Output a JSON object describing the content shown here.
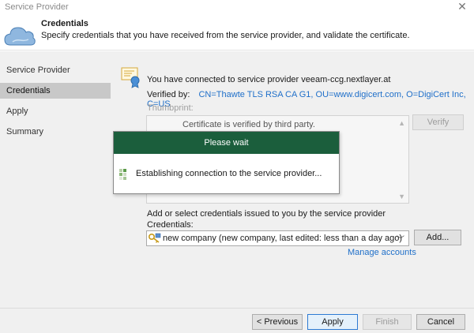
{
  "window": {
    "title": "Service Provider",
    "close_glyph": "✕"
  },
  "header": {
    "title": "Credentials",
    "subtitle": "Specify credentials that you have received from the service provider, and validate the certificate.",
    "icon": "cloud-icon"
  },
  "sidebar": {
    "items": [
      {
        "label": "Service Provider",
        "active": false
      },
      {
        "label": "Credentials",
        "active": true
      },
      {
        "label": "Apply",
        "active": false
      },
      {
        "label": "Summary",
        "active": false
      }
    ]
  },
  "main": {
    "connected_text": "You have connected to service provider veeam-ccg.nextlayer.at",
    "verified_label": "Verified by:",
    "verified_value": "CN=Thawte TLS RSA CA G1, OU=www.digicert.com, O=DigiCert Inc, C=US",
    "thumbprint_label": "Thumbprint:",
    "cert_message": "Certificate is verified by third party.",
    "verify_button": "Verify",
    "select_label": "Add or select credentials issued to you by the service provider",
    "credentials_label": "Credentials:",
    "credentials_value": "new company (new company, last edited: less than a day ago)",
    "add_button": "Add...",
    "manage_link": "Manage accounts"
  },
  "overlay": {
    "title": "Please wait",
    "message": "Establishing connection to the service provider..."
  },
  "footer": {
    "previous": "< Previous",
    "apply": "Apply",
    "finish": "Finish",
    "cancel": "Cancel"
  },
  "colors": {
    "accent_link": "#1f6fc9",
    "overlay_header": "#1b5e3c",
    "active_sidebar": "#c8c8c8",
    "panel_bg": "#f0f0f0"
  }
}
